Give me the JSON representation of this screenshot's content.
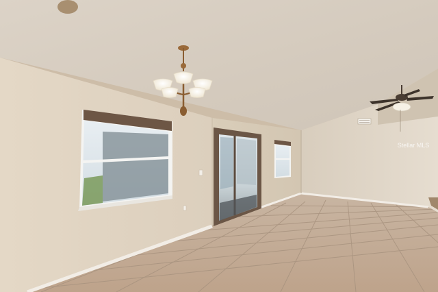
{
  "scene": {
    "subject": "empty-room-interior",
    "watermark": "Stellar MLS",
    "colors": {
      "ceiling": "#d7cec2",
      "wall_left": "#ddd1bf",
      "wall_back": "#d6c9b5",
      "wall_right": "#e0d6c8",
      "floor_tile": "#c4ad97",
      "grout": "#a8937f",
      "baseboard": "#f2ede6",
      "window_frame": "#f4f4f2",
      "window_sky": "#dfe8ee",
      "brass": "#9a6a3a",
      "shade_glass": "#fbf7ee"
    },
    "objects": [
      {
        "name": "chandelier",
        "lights": 5
      },
      {
        "name": "ceiling-fan",
        "blades": 4
      },
      {
        "name": "left-window",
        "panes": 2
      },
      {
        "name": "sliding-glass-door",
        "panels": 2
      },
      {
        "name": "small-back-window",
        "panes": 2
      },
      {
        "name": "wall-vent"
      }
    ]
  }
}
